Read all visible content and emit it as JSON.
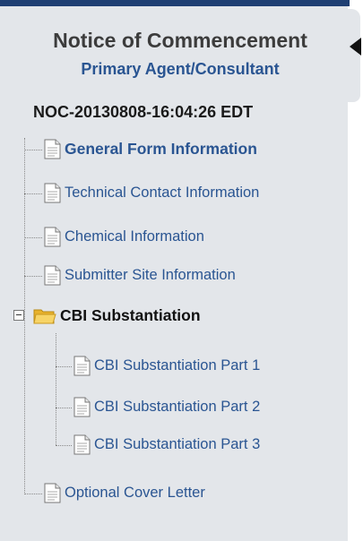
{
  "header": {
    "title": "Notice of Commencement",
    "subtitle": "Primary Agent/Consultant",
    "doc_id": "NOC-20130808-16:04:26 EDT"
  },
  "tree": {
    "general_form": "General Form Information",
    "technical_contact": "Technical Contact Information",
    "chemical_info": "Chemical Information",
    "submitter_site": "Submitter Site Information",
    "cbi_folder": "CBI Substantiation",
    "cbi_part1": "CBI Substantiation Part 1",
    "cbi_part2": "CBI Substantiation Part 2",
    "cbi_part3": "CBI Substantiation Part 3",
    "cover_letter": "Optional Cover Letter"
  },
  "colors": {
    "accent": "#2a5592",
    "topbar": "#1f3f73",
    "panel_bg": "#e3e6ea",
    "folder": "#f4c542"
  },
  "icons": {
    "document": "document-icon",
    "folder": "folder-open-icon",
    "expander": "collapse-minus-icon"
  }
}
